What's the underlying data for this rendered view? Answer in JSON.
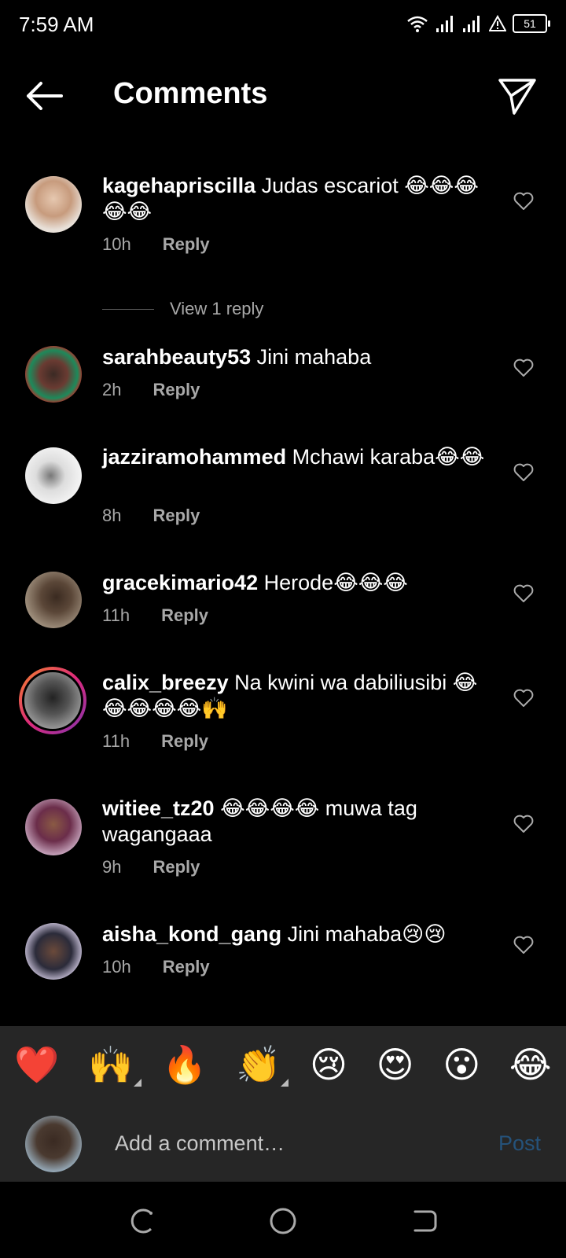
{
  "status": {
    "time": "7:59 AM",
    "battery": "51"
  },
  "header": {
    "title": "Comments"
  },
  "comments": [
    {
      "user": "kagehapriscilla",
      "text": "Judas escariot 😂😂😂😂😂",
      "time": "10h",
      "reply": "Reply",
      "view_replies": "View 1 reply"
    },
    {
      "user": "sarahbeauty53",
      "text": "Jini mahaba",
      "time": "2h",
      "reply": "Reply"
    },
    {
      "user": "jazziramohammed",
      "text": "Mchawi karaba😂😂",
      "time": "8h",
      "reply": "Reply"
    },
    {
      "user": "gracekimario42",
      "text": "Herode😂😂😂",
      "time": "11h",
      "reply": "Reply"
    },
    {
      "user": "calix_breezy",
      "text": "Na kwini wa dabiliusibi 😂😂😂😂😂🙌",
      "time": "11h",
      "reply": "Reply"
    },
    {
      "user": "witiee_tz20",
      "text": "😂😂😂😂 muwa tag wagangaaa",
      "time": "9h",
      "reply": "Reply"
    },
    {
      "user": "aisha_kond_gang",
      "text": "Jini mahaba😢😢",
      "time": "10h",
      "reply": "Reply"
    }
  ],
  "emoji_bar": [
    "❤️",
    "🙌",
    "🔥",
    "👏",
    "😢",
    "😍",
    "😮",
    "😂"
  ],
  "composer": {
    "placeholder": "Add a comment…",
    "post_label": "Post"
  },
  "colors": {
    "background": "#000000",
    "panel": "#262626",
    "muted": "#a8a8a8",
    "post_disabled": "#25527a"
  }
}
